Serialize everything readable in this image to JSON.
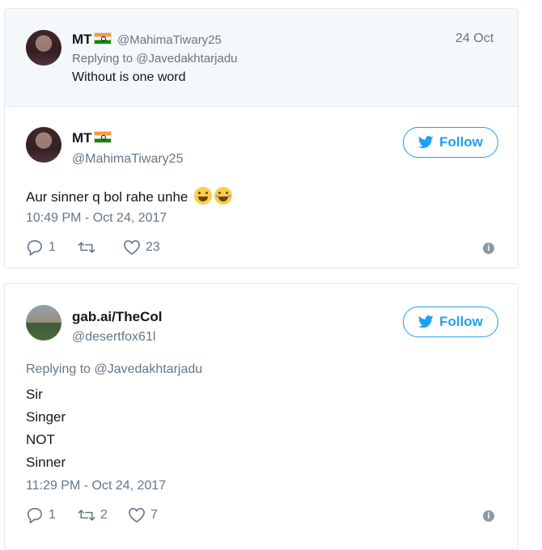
{
  "parent_tweet": {
    "name": "MT",
    "handle": "@MahimaTiwary25",
    "date": "24 Oct",
    "replying_to": "Replying to @Javedakhtarjadu",
    "text": "Without is one word"
  },
  "main_tweet": {
    "name": "MT",
    "handle": "@MahimaTiwary25",
    "follow_label": "Follow",
    "text": "Aur sinner q bol rahe unhe",
    "timestamp": "10:49 PM - Oct 24, 2017",
    "replies": "1",
    "retweets": "",
    "likes": "23"
  },
  "second_tweet": {
    "name": "gab.ai/TheCol",
    "handle": "@desertfox61l",
    "follow_label": "Follow",
    "replying_to": "Replying to @Javedakhtarjadu",
    "lines": [
      "Sir",
      "Singer",
      "NOT",
      "Sinner"
    ],
    "timestamp": "11:29 PM - Oct 24, 2017",
    "replies": "1",
    "retweets": "2",
    "likes": "7"
  },
  "icons": {
    "flag": "india-flag-icon",
    "twitter": "twitter-bird-icon",
    "reply": "reply-icon",
    "retweet": "retweet-icon",
    "like": "heart-icon",
    "info": "info-icon"
  },
  "colors": {
    "accent": "#1da1f2",
    "muted": "#657786",
    "header_bg": "#f5f8fa"
  }
}
